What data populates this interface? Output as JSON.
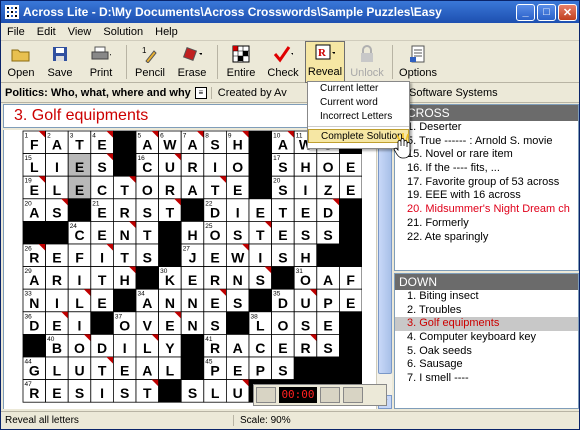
{
  "window": {
    "title": "Across Lite - D:\\My Documents\\Across Crosswords\\Sample Puzzles\\Easy"
  },
  "menu": [
    "File",
    "Edit",
    "View",
    "Solution",
    "Help"
  ],
  "toolbar": {
    "open": "Open",
    "save": "Save",
    "print": "Print",
    "pencil": "Pencil",
    "erase": "Erase",
    "entire": "Entire",
    "check": "Check",
    "reveal": "Reveal",
    "unlock": "Unlock",
    "options": "Options"
  },
  "puzzle": {
    "title": "Politics: Who, what, where and why",
    "author": "Created by Av",
    "copyright": "Software Systems",
    "current_clue": "3. Golf equipments"
  },
  "reveal_menu": {
    "items": [
      "Current letter",
      "Current word",
      "Incorrect Letters"
    ],
    "highlighted": "Complete Solution"
  },
  "across": {
    "header": "ACROSS",
    "clues": [
      {
        "text": "1. Deserter",
        "state": ""
      },
      {
        "text": "5. True ------ : Arnold S. movie",
        "state": ""
      },
      {
        "text": "15. Novel or rare item",
        "state": ""
      },
      {
        "text": "16. If the ---- fits, ...",
        "state": ""
      },
      {
        "text": "17. Favorite group of 53 across",
        "state": ""
      },
      {
        "text": "19. EEE with 16 across",
        "state": ""
      },
      {
        "text": "20. Midsummer's Night Dream ch",
        "state": "red"
      },
      {
        "text": "21. Formerly",
        "state": ""
      },
      {
        "text": "22. Ate sparingly",
        "state": ""
      }
    ]
  },
  "down": {
    "header": "DOWN",
    "clues": [
      {
        "text": "1. Biting insect",
        "state": ""
      },
      {
        "text": "2. Troubles",
        "state": ""
      },
      {
        "text": "3. Golf equipments",
        "state": "sel"
      },
      {
        "text": "4. Computer keyboard key",
        "state": ""
      },
      {
        "text": "5. Oak seeds",
        "state": ""
      },
      {
        "text": "6. Sausage",
        "state": ""
      },
      {
        "text": "7. I smell ----",
        "state": ""
      }
    ]
  },
  "grid": {
    "rows": [
      "FATE#AWASH#AWO",
      "LIES#CURIO#SHOE",
      "ELECTORATE#SIZE",
      "AS#ERST#DIETED",
      "##CENT#HOSTESS",
      "REFITS#JEWISH#",
      "ARITH#KERNS#OAF",
      "NILE#ANNES#DUPE",
      "DEI#OVENS#LOSE",
      "#BODILY#RACERS",
      "GLUTEAL#PEPS##",
      "RESIST#SLU"
    ],
    "numbers": {
      "0,0": "1",
      "0,1": "2",
      "0,2": "3",
      "0,3": "4",
      "0,5": "5",
      "0,6": "6",
      "0,7": "7",
      "0,8": "8",
      "0,9": "9",
      "0,11": "10",
      "0,12": "11",
      "0,13": "12",
      "1,0": "15",
      "1,5": "16",
      "1,11": "17",
      "2,0": "19",
      "2,11": "20",
      "3,0": "20",
      "3,3": "21",
      "3,8": "22",
      "4,2": "24",
      "4,8": "25",
      "5,0": "26",
      "5,7": "27",
      "6,0": "29",
      "6,6": "30",
      "6,12": "31",
      "7,0": "33",
      "7,5": "34",
      "7,11": "35",
      "8,0": "36",
      "8,4": "37",
      "8,10": "38",
      "9,1": "40",
      "9,8": "41",
      "10,0": "44",
      "10,8": "45",
      "11,0": "47"
    },
    "marked_cells": [
      "3,2"
    ],
    "highlighted_cells": [
      "1,2",
      "2,2"
    ],
    "triangle_cells": [
      "0,0",
      "0,3",
      "0,5",
      "0,7",
      "0,9",
      "0,11",
      "0,13",
      "1,3",
      "1,6",
      "1,10",
      "2,0",
      "2,4",
      "2,8",
      "2,10",
      "3,1",
      "3,6",
      "3,13",
      "4,4",
      "4,10",
      "5,0",
      "5,3",
      "5,9",
      "5,13",
      "6,4",
      "6,10",
      "7,2",
      "7,8",
      "7,12",
      "8,1",
      "8,6",
      "8,9",
      "9,2",
      "9,5",
      "9,12",
      "10,3",
      "10,7",
      "11,5",
      "11,9"
    ]
  },
  "timer": {
    "display": "00:00"
  },
  "status": {
    "message": "Reveal all letters",
    "scale": "Scale: 90%"
  }
}
